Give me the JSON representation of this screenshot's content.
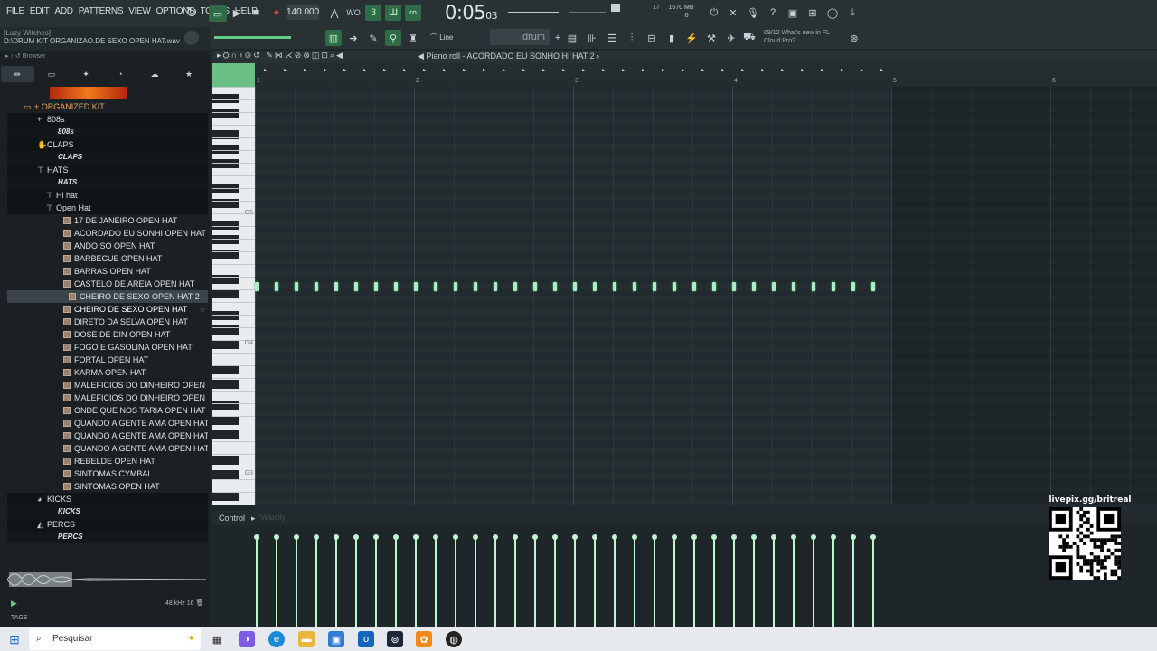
{
  "menu": [
    "FILE",
    "EDIT",
    "ADD",
    "PATTERNS",
    "VIEW",
    "OPTIONS",
    "TOOLS",
    "HELP"
  ],
  "transport": {
    "tempo": "140.000",
    "time_main": "0:05",
    "time_sub": "03",
    "cpu_value": "17",
    "mem": "1670 MB",
    "mem_sub": "0"
  },
  "hint": {
    "line1": "[Lazy Witches]",
    "line2": "D:\\DRUM KIT ORGANIZAO.DE SEXO OPEN HAT.wav"
  },
  "toolbar2": {
    "snap": "Line",
    "pattern": "drum"
  },
  "news": {
    "line1": "09/12  What's new in FL",
    "line2": "Cloud Pro?"
  },
  "browser": {
    "title": "Browser",
    "tree": [
      {
        "label": "+ ORGANIZED KIT",
        "type": "org",
        "indent": 30
      },
      {
        "label": "808s",
        "type": "folder",
        "indent": 44,
        "icon": "plus-icon"
      },
      {
        "label": "808s",
        "type": "sub",
        "indent": 56
      },
      {
        "label": "CLAPS",
        "type": "folder",
        "indent": 44,
        "icon": "clap-icon"
      },
      {
        "label": "CLAPS",
        "type": "sub",
        "indent": 56
      },
      {
        "label": "HATS",
        "type": "folder",
        "indent": 44,
        "icon": "hat-icon"
      },
      {
        "label": "HATS",
        "type": "sub",
        "indent": 56
      },
      {
        "label": "Hi hat",
        "type": "folder",
        "indent": 54,
        "icon": "hat-icon"
      },
      {
        "label": "Open Hat",
        "type": "folder",
        "indent": 54,
        "icon": "hat-icon"
      },
      {
        "label": "17 DE JANEIRO OPEN HAT",
        "type": "file",
        "indent": 62
      },
      {
        "label": "ACORDADO EU SONHI OPEN HAT",
        "type": "file",
        "indent": 62
      },
      {
        "label": "ANDO SO OPEN HAT",
        "type": "file",
        "indent": 62
      },
      {
        "label": "BARBECUE OPEN HAT",
        "type": "file",
        "indent": 62
      },
      {
        "label": "BARRAS OPEN HAT",
        "type": "file",
        "indent": 62
      },
      {
        "label": "CASTELO DE AREIA OPEN HAT",
        "type": "file",
        "indent": 62
      },
      {
        "label": "CHEIRO DE SEXO OPEN HAT 2",
        "type": "file sel",
        "indent": 68
      },
      {
        "label": "CHEIRO DE SEXO OPEN HAT",
        "type": "file hl",
        "indent": 62
      },
      {
        "label": "DIRETO DA SELVA OPEN HAT",
        "type": "file",
        "indent": 62
      },
      {
        "label": "DOSE DE DIN OPEN HAT",
        "type": "file",
        "indent": 62
      },
      {
        "label": "FOGO E GASOLINA OPEN HAT",
        "type": "file",
        "indent": 62
      },
      {
        "label": "FORTAL OPEN HAT",
        "type": "file",
        "indent": 62
      },
      {
        "label": "KARMA OPEN HAT",
        "type": "file",
        "indent": 62
      },
      {
        "label": "MALEFICIOS DO DINHEIRO OPEN HAT 2",
        "type": "file",
        "indent": 62
      },
      {
        "label": "MALEFICIOS DO DINHEIRO OPEN HAT",
        "type": "file",
        "indent": 62
      },
      {
        "label": "ONDE QUE NOS TARIA OPEN HAT",
        "type": "file",
        "indent": 62
      },
      {
        "label": "QUANDO A GENTE AMA OPEN HAT 2",
        "type": "file",
        "indent": 62
      },
      {
        "label": "QUANDO A GENTE AMA OPEN HAT 3",
        "type": "file",
        "indent": 62
      },
      {
        "label": "QUANDO A GENTE AMA OPEN HAT",
        "type": "file",
        "indent": 62
      },
      {
        "label": "REBELDE OPEN HAT",
        "type": "file",
        "indent": 62
      },
      {
        "label": "SINTOMAS CYMBAL",
        "type": "file",
        "indent": 62
      },
      {
        "label": "SINTOMAS OPEN HAT",
        "type": "file",
        "indent": 62
      },
      {
        "label": "KICKS",
        "type": "folder",
        "indent": 44,
        "icon": "kick-icon"
      },
      {
        "label": "KICKS",
        "type": "sub",
        "indent": 56
      },
      {
        "label": "PERCS",
        "type": "folder",
        "indent": 44,
        "icon": "perc-icon"
      },
      {
        "label": "PERCS",
        "type": "sub",
        "indent": 56
      }
    ],
    "sample_rate": "48 kHz 16",
    "tags_label": "TAGS"
  },
  "piano_roll": {
    "title": "Piano roll - ACORDADO EU SONHO HI HAT 2",
    "bars": [
      "1",
      "2",
      "3",
      "4",
      "5",
      "6"
    ],
    "key_labels": [
      "G5",
      "G4",
      "G3"
    ],
    "note_count": 32,
    "control_label": "Control",
    "control_sub": "Velocity"
  },
  "qr": {
    "label": "livepix.gg/britreal"
  },
  "taskbar": {
    "search_placeholder": "Pesquisar"
  }
}
